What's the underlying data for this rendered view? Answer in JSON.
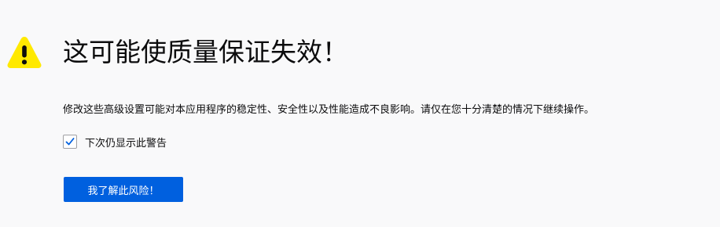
{
  "page": {
    "title": "这可能使质量保证失效！",
    "description": "修改这些高级设置可能对本应用程序的稳定性、安全性以及性能造成不良影响。请仅在您十分清楚的情况下继续操作。",
    "warning_checkbox": {
      "label": "下次仍显示此警告",
      "checked": true
    },
    "accept_button_label": "我了解此风险！"
  },
  "colors": {
    "background": "#f9f9fa",
    "warning_icon": "#ffe900",
    "accent": "#0060df",
    "checkmark": "#0060df"
  },
  "icons": {
    "warning": "warning-triangle-icon",
    "check": "checkmark-icon"
  }
}
